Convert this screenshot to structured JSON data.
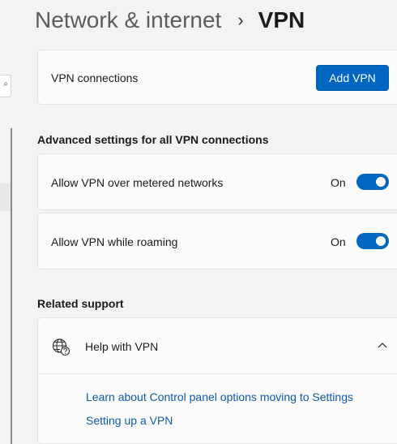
{
  "header": {
    "breadcrumb_parent": "Network & internet",
    "breadcrumb_separator": "›",
    "breadcrumb_current": "VPN"
  },
  "vpn_connections": {
    "label": "VPN connections",
    "add_button_label": "Add VPN"
  },
  "advanced": {
    "title": "Advanced settings for all VPN connections",
    "settings": [
      {
        "label": "Allow VPN over metered networks",
        "state": "On"
      },
      {
        "label": "Allow VPN while roaming",
        "state": "On"
      }
    ]
  },
  "related_support": {
    "title": "Related support",
    "item_title": "Help with VPN",
    "links": [
      "Learn about Control panel options moving to Settings",
      "Setting up a VPN"
    ]
  },
  "colors": {
    "accent": "#0067c0",
    "link": "#0f5aa8",
    "background": "#f3f3f3",
    "card": "#fbfbfb"
  },
  "icons": {
    "globe": "globe-question-icon",
    "chevron": "chevron-up-icon",
    "separator": "chevron-right-icon"
  }
}
